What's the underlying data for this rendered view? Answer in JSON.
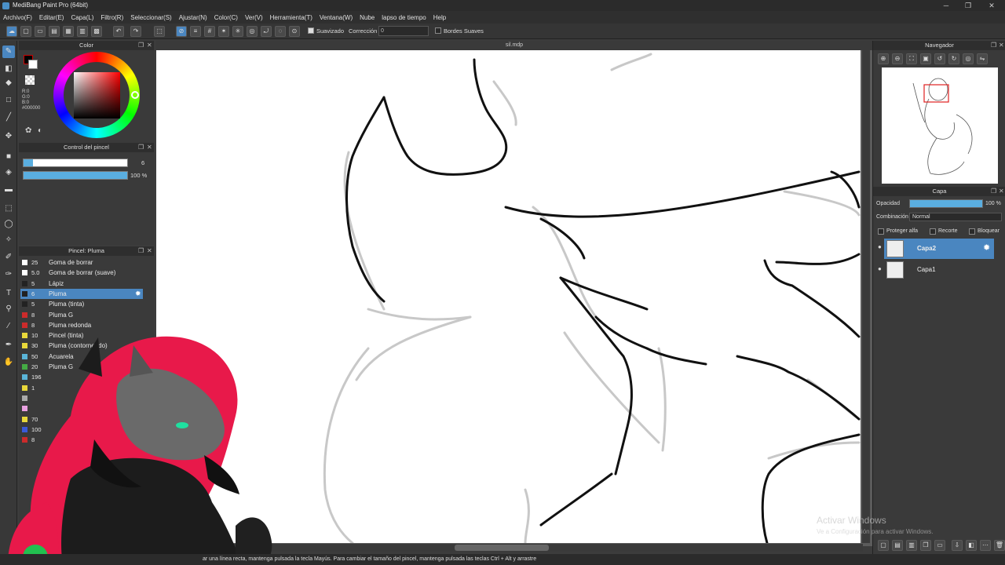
{
  "app": {
    "title": "MediBang Paint Pro (64bit)"
  },
  "menu": [
    "Archivo(F)",
    "Editar(E)",
    "Capa(L)",
    "Filtro(R)",
    "Seleccionar(S)",
    "Ajustar(N)",
    "Color(C)",
    "Ver(V)",
    "Herramienta(T)",
    "Ventana(W)",
    "Nube",
    "lapso de tiempo",
    "Help"
  ],
  "toolbar": {
    "smooth_label": "Suavizado",
    "correction_label": "Corrección",
    "correction_value": "0",
    "soft_edges_label": "Bordes Suaves"
  },
  "document": {
    "tab": "sil.mdp"
  },
  "color_panel": {
    "title": "Color",
    "r": "R:0",
    "g": "G:0",
    "b": "B:0",
    "hex": "#000000"
  },
  "brush_control": {
    "title": "Control del pincel",
    "size": "6",
    "opacity": "100 %"
  },
  "brush_list": {
    "title": "Pincel: Pluma",
    "items": [
      {
        "size": "25",
        "name": "Goma de borrar",
        "color": "#ffffff"
      },
      {
        "size": "5.0",
        "name": "Goma de borrar (suave)",
        "color": "#ffffff"
      },
      {
        "size": "5",
        "name": "Lápiz",
        "color": "#222222"
      },
      {
        "size": "6",
        "name": "Pluma",
        "color": "#222222"
      },
      {
        "size": "5",
        "name": "Pluma (tinta)",
        "color": "#222222"
      },
      {
        "size": "8",
        "name": "Pluma G",
        "color": "#cc2b2b"
      },
      {
        "size": "8",
        "name": "Pluma redonda",
        "color": "#cc2b2b"
      },
      {
        "size": "10",
        "name": "Pincel (tinta)",
        "color": "#e8d83a"
      },
      {
        "size": "30",
        "name": "Pluma (contorneado)",
        "color": "#e8d83a"
      },
      {
        "size": "50",
        "name": "Acuarela",
        "color": "#5ab5d8"
      },
      {
        "size": "20",
        "name": "Pluma G",
        "color": "#44aa44"
      },
      {
        "size": "196",
        "name": "",
        "color": "#5ab5d8"
      },
      {
        "size": "1",
        "name": "",
        "color": "#e8d83a"
      },
      {
        "size": "",
        "name": "",
        "color": "#aaaaaa"
      },
      {
        "size": "",
        "name": "",
        "color": "#e8a0e0"
      },
      {
        "size": "70",
        "name": "",
        "color": "#e8d83a"
      },
      {
        "size": "100",
        "name": "",
        "color": "#3a5ad8"
      },
      {
        "size": "8",
        "name": "",
        "color": "#cc2b2b"
      }
    ]
  },
  "navigator": {
    "title": "Navegador"
  },
  "layers": {
    "title": "Capa",
    "opacity_label": "Opacidad",
    "opacity_value": "100 %",
    "blend_label": "Combinación",
    "blend_value": "Normal",
    "protect_alpha": "Proteger alfa",
    "clip": "Recorte",
    "lock": "Bloquear",
    "items": [
      {
        "name": "Capa2"
      },
      {
        "name": "Capa1"
      }
    ]
  },
  "status": {
    "text": "ar una línea recta, mantenga pulsada la tecla Mayús. Para cambiar el tamaño del pincel, mantenga pulsada las teclas Ctrl + Alt y arrastre"
  },
  "watermark": {
    "line1": "Activar Windows",
    "line2": "Ve a Configuración para activar Windows."
  }
}
